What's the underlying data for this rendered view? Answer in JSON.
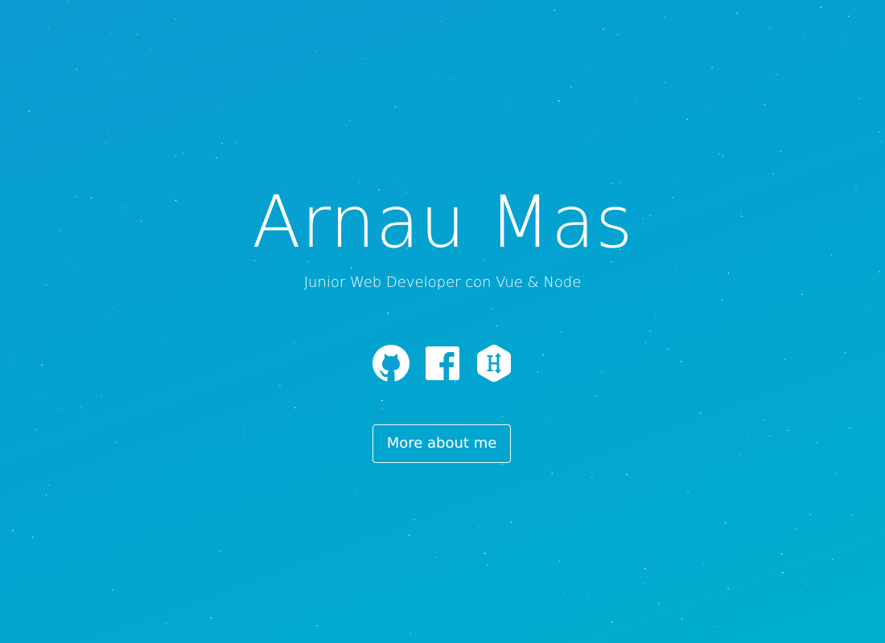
{
  "hero": {
    "name": "Arnau Mas",
    "subtitle": "Junior Web Developer con Vue & Node",
    "cta_label": "More about me",
    "background_colors": [
      "#0c9cd2",
      "#00aecd"
    ]
  },
  "socials": [
    {
      "icon": "github-icon",
      "label": "GitHub"
    },
    {
      "icon": "facebook-icon",
      "label": "Facebook"
    },
    {
      "icon": "hackerrank-icon",
      "label": "HackerRank"
    }
  ]
}
